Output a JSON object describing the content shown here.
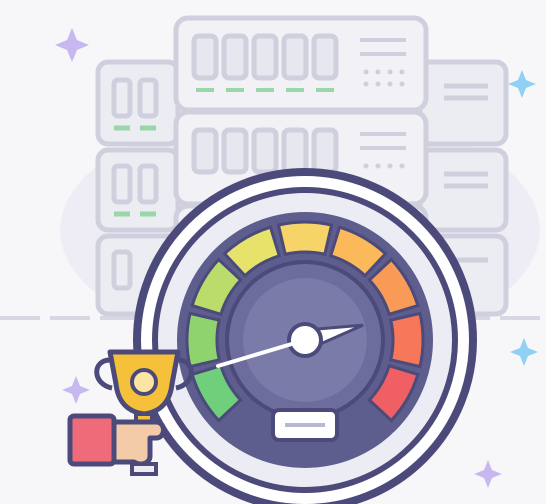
{
  "illustration": {
    "subject": "server-performance-speedometer",
    "elements": [
      "server-rack-icon",
      "speedometer-gauge-icon",
      "trophy-icon",
      "hand-icon",
      "sparkle-icon"
    ]
  },
  "gauge": {
    "level": 0.78,
    "segment_colors": [
      "#6fcf7a",
      "#8fd36e",
      "#b9dc6a",
      "#e7e36a",
      "#f7d468",
      "#fbb95a",
      "#fa9a57",
      "#f6775a",
      "#ef5f63"
    ]
  },
  "colors": {
    "background": "#f7f7f9",
    "halo": "#e9e8f4",
    "server_fill": "#ececf3",
    "server_stroke": "#c9c9d9",
    "led_green": "#9ad7a8",
    "gauge_outer": "#4b4a7a",
    "gauge_face": "#5d5e8d",
    "gauge_ring": "#e6e6f2",
    "needle": "#ffffff",
    "trophy": "#f5c13b",
    "sleeve": "#f06b7a",
    "sparkle_purple": "#c4b4ef",
    "sparkle_blue": "#8fd0f4"
  }
}
